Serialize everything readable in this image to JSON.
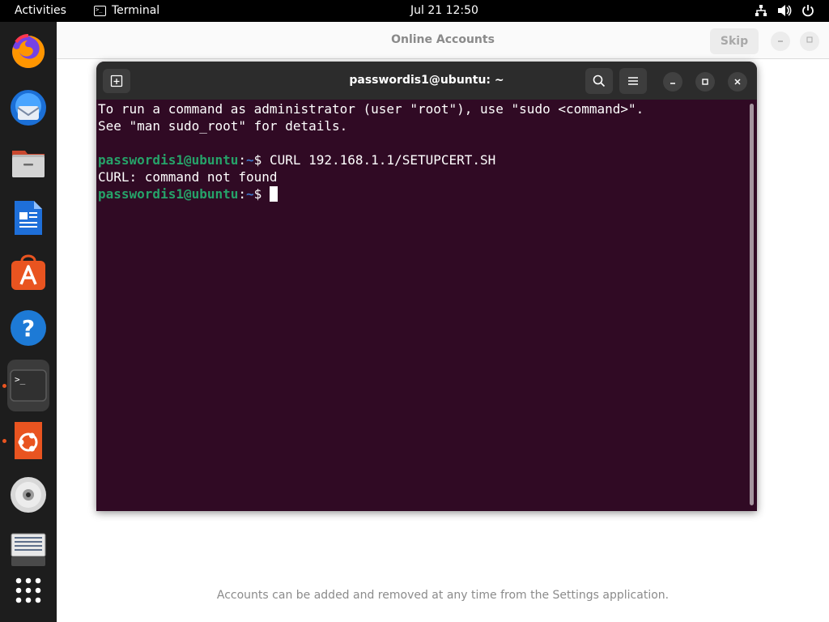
{
  "topbar": {
    "activities": "Activities",
    "app_name": "Terminal",
    "clock": "Jul 21  12:50",
    "status_icons": [
      "network-icon",
      "volume-icon",
      "power-icon"
    ]
  },
  "dock": {
    "items": [
      {
        "name": "firefox",
        "icon": "firefox-icon"
      },
      {
        "name": "thunderbird",
        "icon": "thunderbird-icon"
      },
      {
        "name": "files",
        "icon": "files-icon"
      },
      {
        "name": "libreoffice-writer",
        "icon": "writer-icon"
      },
      {
        "name": "ubuntu-software",
        "icon": "software-icon"
      },
      {
        "name": "help",
        "icon": "help-icon"
      },
      {
        "name": "terminal",
        "icon": "terminal-icon",
        "active": true,
        "running": true
      },
      {
        "name": "ubuntu-installer",
        "icon": "ubuntu-icon",
        "running": true
      },
      {
        "name": "disc",
        "icon": "disc-icon"
      },
      {
        "name": "trash-or-drive",
        "icon": "drive-icon"
      },
      {
        "name": "show-apps",
        "icon": "app-grid-icon"
      }
    ]
  },
  "online_accounts": {
    "title": "Online Accounts",
    "skip_label": "Skip",
    "footer": "Accounts can be added and removed at any time from the Settings application."
  },
  "terminal": {
    "title": "passwordis1@ubuntu: ~",
    "lines": {
      "sudo_line1": "To run a command as administrator (user \"root\"), use \"sudo <command>\".",
      "sudo_line2": "See \"man sudo_root\" for details.",
      "prompt_user": "passwordis1@ubuntu",
      "prompt_sep": ":",
      "prompt_path": "~",
      "prompt_symbol": "$ ",
      "command": "CURL 192.168.1.1/SETUPCERT.SH",
      "error": "CURL: command not found"
    }
  },
  "colors": {
    "terminal_bg": "#300a24",
    "prompt_user": "#26a269",
    "prompt_path": "#3b74c7",
    "accent": "#e95420"
  }
}
